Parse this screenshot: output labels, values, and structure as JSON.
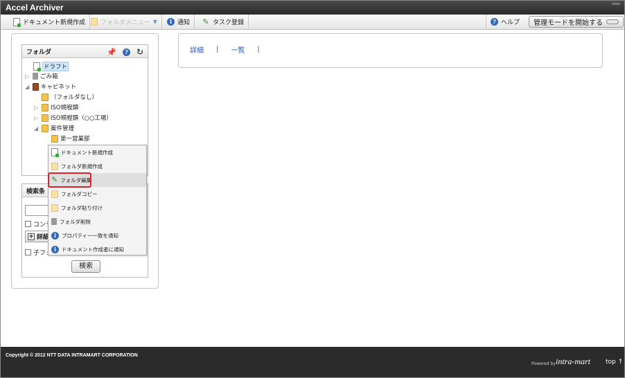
{
  "app": {
    "title": "Accel Archiver"
  },
  "toolbar": {
    "new_document": "ドキュメント新規作成",
    "folder_menu": "フォルダメニュー",
    "notice": "通知",
    "task_register": "タスク登録",
    "help": "ヘルプ",
    "admin_mode": "管理モードを開始する"
  },
  "folder_panel": {
    "title": "フォルダ",
    "tree": [
      {
        "label": "ドラフト",
        "icon": "document-icon",
        "selected": true
      },
      {
        "label": "ごみ箱",
        "icon": "trash-icon",
        "arrow": "▷"
      },
      {
        "label": "キャビネット",
        "icon": "cabinet-icon",
        "arrow": "◢"
      },
      {
        "label": "（フォルダなし）",
        "icon": "folder-icon"
      },
      {
        "label": "ISO規程類",
        "icon": "folder-icon",
        "arrow": "▷"
      },
      {
        "label": "ISO規程類（○○工場）",
        "icon": "folder-icon",
        "arrow": "▷"
      },
      {
        "label": "案件管理",
        "icon": "folder-icon",
        "arrow": "◢"
      },
      {
        "label": "第一営業部",
        "icon": "folder-icon"
      }
    ]
  },
  "context_menu": {
    "items": [
      {
        "label": "ドキュメント新規作成",
        "icon": "new-document-icon"
      },
      {
        "label": "フォルダ新規作成",
        "icon": "new-folder-icon"
      },
      {
        "label": "フォルダ編集",
        "icon": "pencil-icon"
      },
      {
        "label": "フォルダコピー",
        "icon": "folder-copy-icon"
      },
      {
        "label": "フォルダ貼り付け",
        "icon": "folder-paste-icon"
      },
      {
        "label": "フォルダ削除",
        "icon": "trash-icon"
      },
      {
        "label": "プロパティー一致を通知",
        "icon": "info-icon"
      },
      {
        "label": "ドキュメント作成者に通知",
        "icon": "info-icon"
      }
    ]
  },
  "search_panel": {
    "title": "検索条",
    "content_checkbox": "コンテ",
    "detail_button": "詳細",
    "child_checkbox": "子フォ",
    "submit": "検索"
  },
  "view_tabs": {
    "detail": "詳細",
    "list": "一覧",
    "separator": "|"
  },
  "footer": {
    "copyright": "Copyright © 2012 NTT DATA INTRAMART CORPORATION",
    "powered_by": "Powered by",
    "brand": "intra-mart",
    "top_link": "top ↑"
  }
}
